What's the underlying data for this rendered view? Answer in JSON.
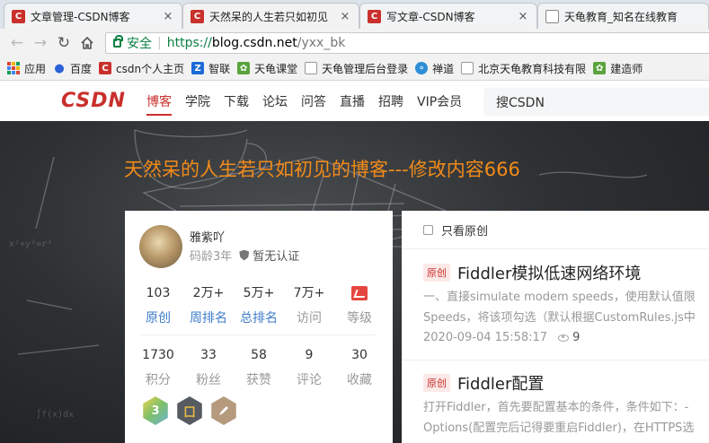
{
  "browser": {
    "tabs": [
      {
        "title": "文章管理-CSDN博客",
        "close": "×"
      },
      {
        "title": "天然呆的人生若只如初见",
        "close": "×"
      },
      {
        "title": "写文章-CSDN博客",
        "close": "×"
      },
      {
        "title": "天龟教育_知名在线教育",
        "close": "×"
      }
    ],
    "address": {
      "secure_label": "安全",
      "protocol": "https://",
      "host": "blog.csdn.net",
      "path": "/yxx_bk"
    },
    "bookmarks": [
      {
        "label": "应用",
        "icon": "apps-grid-icon"
      },
      {
        "label": "百度",
        "icon": "baidu-paw-icon",
        "color": "#2b62d8"
      },
      {
        "label": "csdn个人主页",
        "icon": "csdn-icon",
        "color": "#c9302c"
      },
      {
        "label": "智联",
        "icon": "zhilian-icon",
        "color": "#1c6ad6"
      },
      {
        "label": "天龟课堂",
        "icon": "tiangui-icon",
        "color": "#5aa33d"
      },
      {
        "label": "天龟管理后台登录",
        "icon": "page-icon",
        "color": "#ffffff"
      },
      {
        "label": "禅道",
        "icon": "chandao-icon",
        "color": "#2d8ed6"
      },
      {
        "label": "北京天龟教育科技有限",
        "icon": "page-icon",
        "color": "#ffffff"
      },
      {
        "label": "建造师",
        "icon": "tiangui-icon",
        "color": "#5aa33d"
      }
    ]
  },
  "csdn": {
    "logo": "CSDN",
    "nav": [
      "博客",
      "学院",
      "下载",
      "论坛",
      "问答",
      "直播",
      "招聘",
      "VIP会员"
    ],
    "search_placeholder": "搜CSDN"
  },
  "blog": {
    "title": "天然呆的人生若只如初见的博客---修改内容666"
  },
  "profile": {
    "name": "雅紫吖",
    "age": "码龄3年",
    "auth": "暂无认证",
    "row1": [
      {
        "value": "103",
        "label": "原创"
      },
      {
        "value": "2万+",
        "label": "周排名"
      },
      {
        "value": "5万+",
        "label": "总排名"
      },
      {
        "value": "7万+",
        "label": "访问"
      },
      {
        "value": "",
        "label": "等级"
      }
    ],
    "row2": [
      {
        "value": "1730",
        "label": "积分"
      },
      {
        "value": "33",
        "label": "粉丝"
      },
      {
        "value": "58",
        "label": "获赞"
      },
      {
        "value": "9",
        "label": "评论"
      },
      {
        "value": "30",
        "label": "收藏"
      }
    ],
    "badges": [
      {
        "icon": "badge-3-icon",
        "text": "3",
        "color": "#9ccc4a"
      },
      {
        "icon": "badge-blog-icon",
        "text": "囗",
        "color": "#555b60"
      },
      {
        "icon": "badge-pen-icon",
        "text": "",
        "color": "#b59a7e"
      }
    ]
  },
  "articles": {
    "filter_label": "只看原创",
    "items": [
      {
        "tag": "原创",
        "title": "Fiddler模拟低速网络环境",
        "desc1": "一、直接simulate modem speeds，使用默认值限",
        "desc2": "Speeds，将该项勾选（默认根据CustomRules.js中",
        "date": "2020-09-04 15:58:17",
        "views": "9"
      },
      {
        "tag": "原创",
        "title": "Fiddler配置",
        "desc1": "打开Fiddler，首先要配置基本的条件，条件如下：-",
        "desc2": "Options(配置完后记得要重启Fiddler)，在HTTPS选"
      }
    ]
  }
}
